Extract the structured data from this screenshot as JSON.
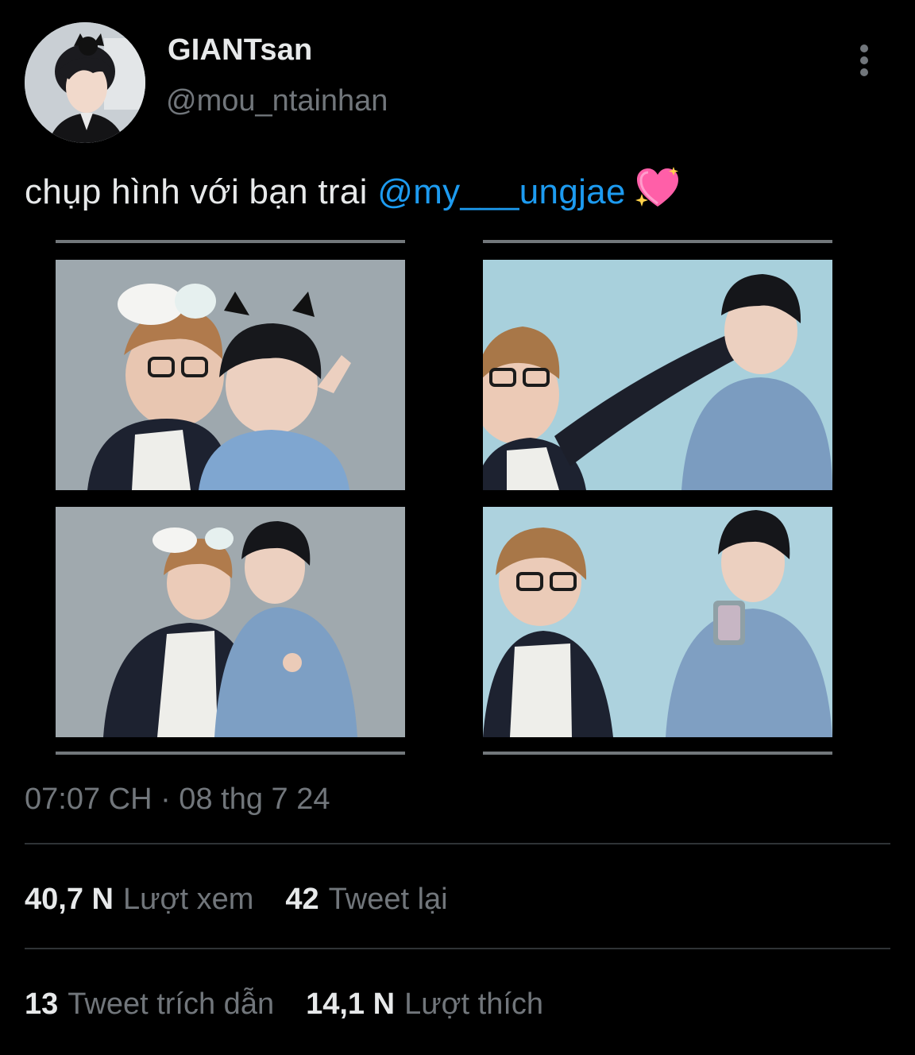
{
  "colors": {
    "background": "#000000",
    "primary_text": "#e7e9ea",
    "secondary_text": "#71767b",
    "mention": "#1d9bf0",
    "divider": "#2f3336"
  },
  "author": {
    "display_name": "GIANTsan",
    "handle": "@mou_ntainhan",
    "avatar_icon": "profile-photo"
  },
  "more_icon": "more-vertical-icon",
  "tweet": {
    "text": "chụp hình với bạn trai ",
    "mention": "@my___ungjae",
    "emoji": "sparkling-heart-emoji"
  },
  "media": {
    "photos": [
      "photo-booth-shot-1",
      "photo-booth-shot-2",
      "photo-booth-shot-3",
      "photo-booth-shot-4"
    ]
  },
  "timestamp": "07:07 CH · 08 thg 7 24",
  "stats": {
    "views_count": "40,7 N",
    "views_label": "Lượt xem",
    "retweets_count": "42",
    "retweets_label": "Tweet lại",
    "quotes_count": "13",
    "quotes_label": "Tweet trích dẫn",
    "likes_count": "14,1 N",
    "likes_label": "Lượt thích"
  }
}
